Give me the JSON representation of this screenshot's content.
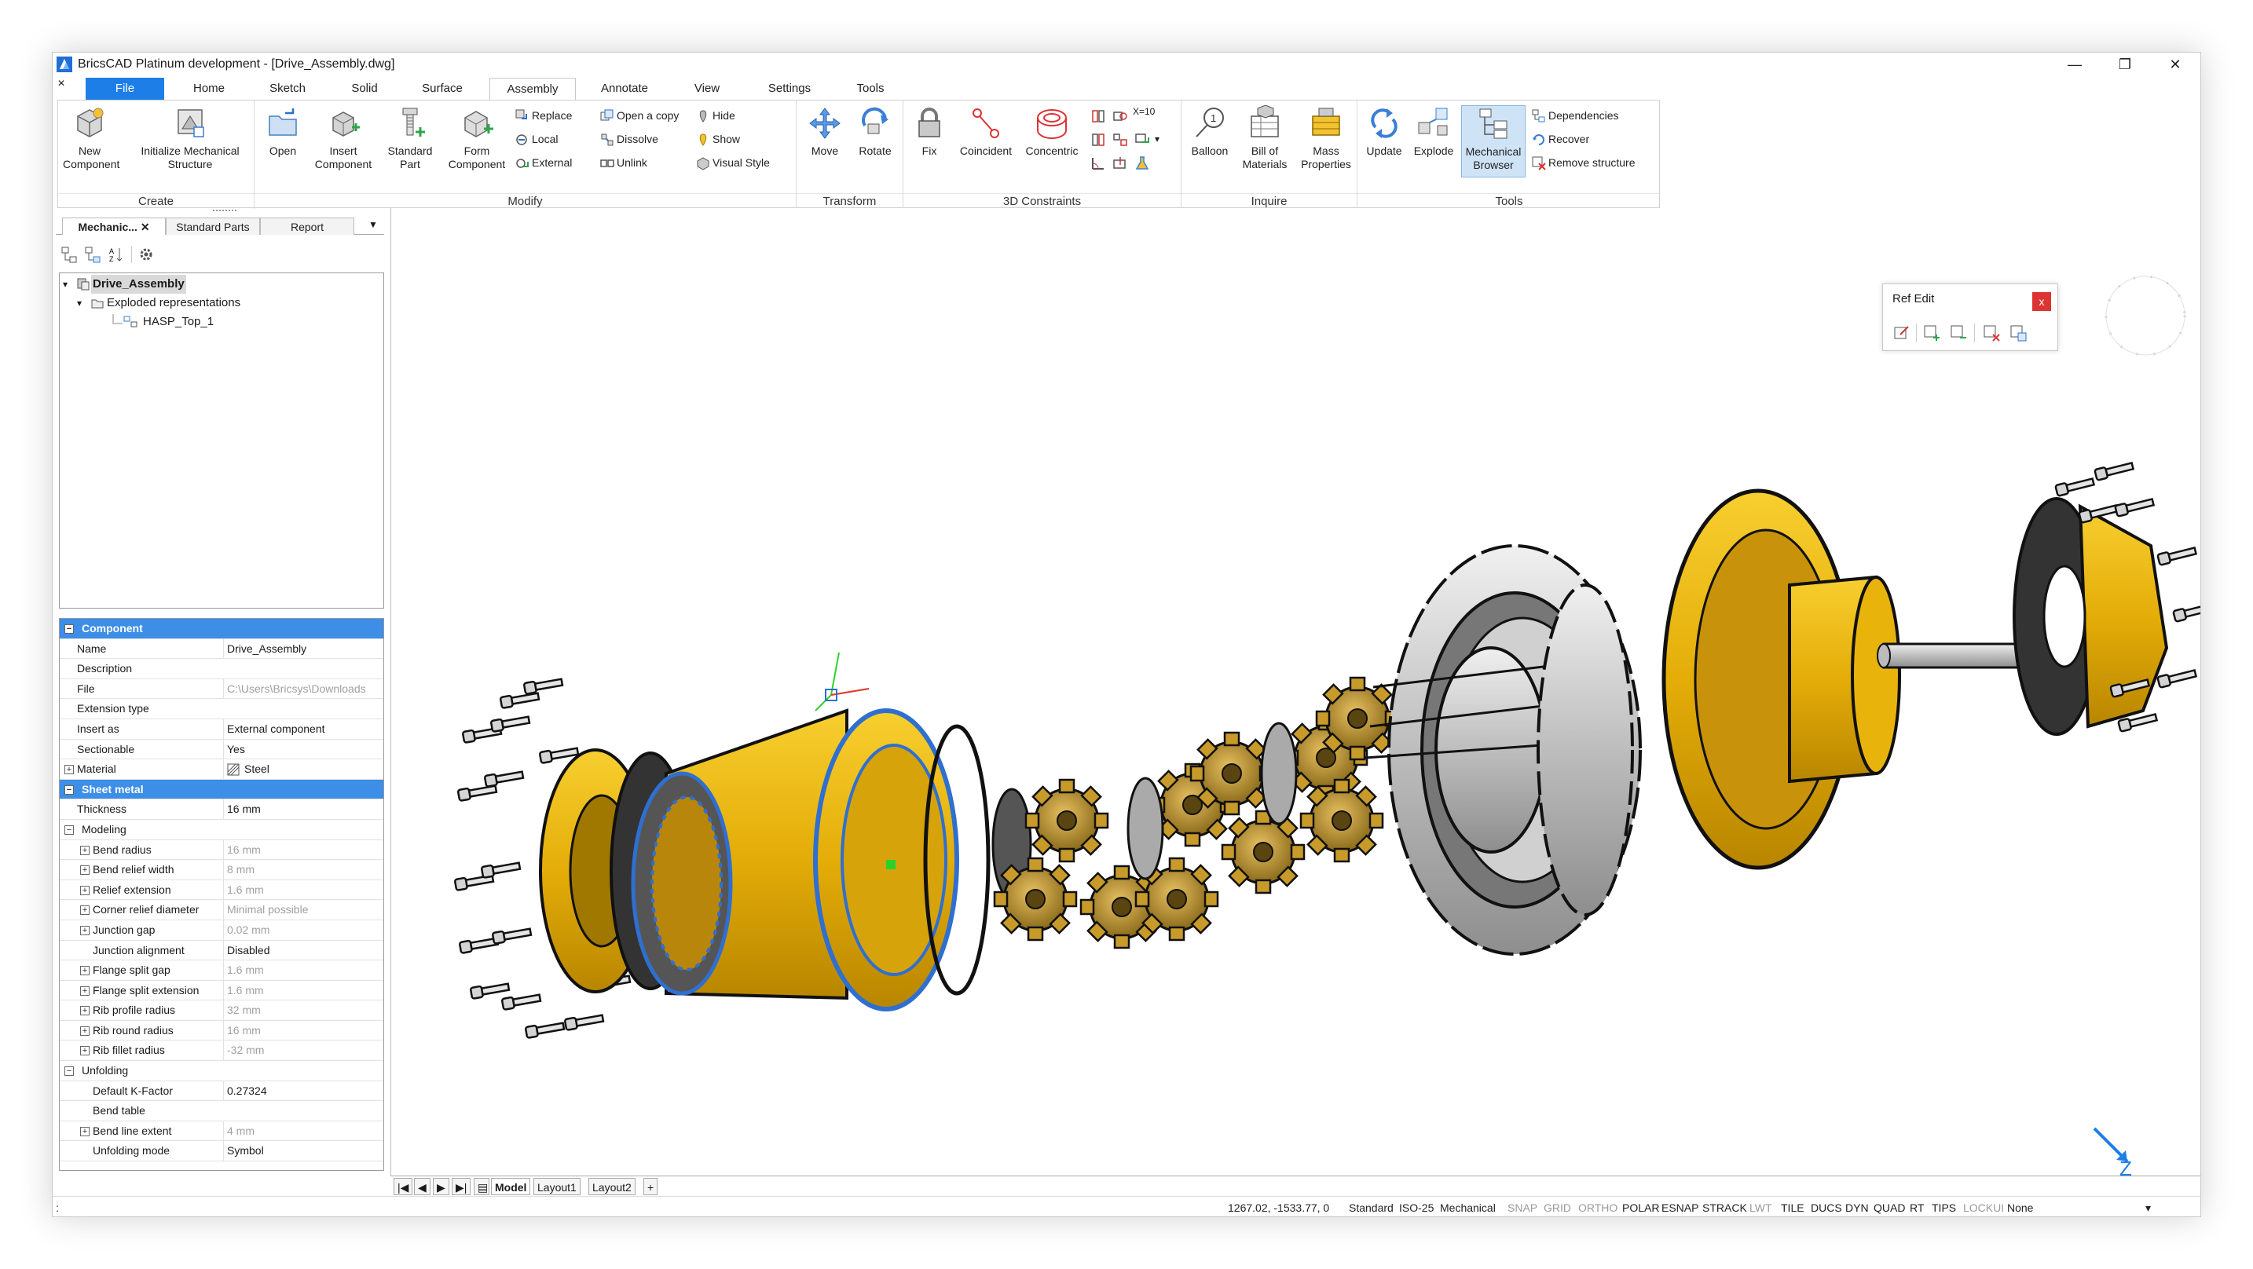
{
  "window": {
    "title": "BricsCAD Platinum development - [Drive_Assembly.dwg]",
    "controls": {
      "minimize": "—",
      "restore": "❐",
      "close": "✕"
    }
  },
  "ribbon_tabs": [
    "File",
    "Home",
    "Sketch",
    "Solid",
    "Surface",
    "Assembly",
    "Annotate",
    "View",
    "Settings",
    "Tools"
  ],
  "ribbon": {
    "create": {
      "title": "Create",
      "new_component": "New Component",
      "initialize": "Initialize Mechanical Structure"
    },
    "modify": {
      "title": "Modify",
      "open": "Open",
      "insert_component": "Insert Component",
      "standard_part": "Standard Part",
      "form_component": "Form Component",
      "replace": "Replace",
      "local": "Local",
      "external": "External",
      "open_copy": "Open a copy",
      "dissolve": "Dissolve",
      "unlink": "Unlink",
      "hide": "Hide",
      "show": "Show",
      "visual_style": "Visual Style"
    },
    "transform": {
      "title": "Transform",
      "move": "Move",
      "rotate": "Rotate"
    },
    "constraints": {
      "title": "3D Constraints",
      "fix": "Fix",
      "coincident": "Coincident",
      "concentric": "Concentric",
      "xlabel": "X=10"
    },
    "inquire": {
      "title": "Inquire",
      "balloon": "Balloon",
      "bom": "Bill of Materials",
      "mass": "Mass Properties"
    },
    "tools": {
      "title": "Tools",
      "update": "Update",
      "explode": "Explode",
      "mech_browser": "Mechanical Browser",
      "dependencies": "Dependencies",
      "recover": "Recover",
      "remove_structure": "Remove structure"
    }
  },
  "left_tabs": [
    "Mechanic...",
    "Standard Parts",
    "Report"
  ],
  "left_tab_close": "✕",
  "tree": {
    "root": "Drive_Assembly",
    "child": "Exploded representations",
    "leaf": "HASP_Top_1"
  },
  "properties": [
    {
      "kind": "sec",
      "name": "Component",
      "exp": "⊟"
    },
    {
      "kind": "row",
      "name": "Name",
      "value": "Drive_Assembly"
    },
    {
      "kind": "row",
      "name": "Description",
      "value": ""
    },
    {
      "kind": "row",
      "name": "File",
      "value": "C:\\Users\\Bricsys\\Downloads",
      "gray": true
    },
    {
      "kind": "row",
      "name": "Extension type",
      "value": ""
    },
    {
      "kind": "row",
      "name": "Insert as",
      "value": "External component"
    },
    {
      "kind": "row",
      "name": "Sectionable",
      "value": "Yes"
    },
    {
      "kind": "row",
      "name": "Material",
      "value": "Steel",
      "exp": "⊞",
      "hatch": true
    },
    {
      "kind": "sec",
      "name": "Sheet metal",
      "exp": "⊟"
    },
    {
      "kind": "row",
      "name": "Thickness",
      "value": "16 mm"
    },
    {
      "kind": "grp",
      "name": "Modeling",
      "exp": "⊟"
    },
    {
      "kind": "sub",
      "name": "Bend radius",
      "value": "16 mm",
      "gray": true,
      "exp": "⊞"
    },
    {
      "kind": "sub",
      "name": "Bend relief width",
      "value": "8 mm",
      "gray": true,
      "exp": "⊞"
    },
    {
      "kind": "sub",
      "name": "Relief extension",
      "value": "1.6 mm",
      "gray": true,
      "exp": "⊞"
    },
    {
      "kind": "sub",
      "name": "Corner relief diameter",
      "value": "Minimal possible",
      "gray": true,
      "exp": "⊞"
    },
    {
      "kind": "sub",
      "name": "Junction gap",
      "value": "0.02 mm",
      "gray": true,
      "exp": "⊞"
    },
    {
      "kind": "sub",
      "name": "Junction alignment",
      "value": "Disabled"
    },
    {
      "kind": "sub",
      "name": "Flange split gap",
      "value": "1.6 mm",
      "gray": true,
      "exp": "⊞"
    },
    {
      "kind": "sub",
      "name": "Flange split extension",
      "value": "1.6 mm",
      "gray": true,
      "exp": "⊞"
    },
    {
      "kind": "sub",
      "name": "Rib profile radius",
      "value": "32 mm",
      "gray": true,
      "exp": "⊞"
    },
    {
      "kind": "sub",
      "name": "Rib round radius",
      "value": "16 mm",
      "gray": true,
      "exp": "⊞"
    },
    {
      "kind": "sub",
      "name": "Rib fillet radius",
      "value": "-32 mm",
      "gray": true,
      "exp": "⊞"
    },
    {
      "kind": "grp",
      "name": "Unfolding",
      "exp": "⊟"
    },
    {
      "kind": "sub",
      "name": "Default K-Factor",
      "value": "0.27324"
    },
    {
      "kind": "sub",
      "name": "Bend table",
      "value": ""
    },
    {
      "kind": "sub",
      "name": "Bend line extent",
      "value": "4 mm",
      "gray": true,
      "exp": "⊞"
    },
    {
      "kind": "sub",
      "name": "Unfolding mode",
      "value": "Symbol"
    }
  ],
  "refedit": {
    "title": "Ref Edit",
    "close": "x"
  },
  "axis_label": "Z",
  "layout_tabs": [
    "Model",
    "Layout1",
    "Layout2"
  ],
  "layout_nav": [
    "|◀",
    "◀",
    "▶",
    "▶|",
    "+"
  ],
  "status": {
    "coords": "1267.02, -1533.77, 0",
    "items": [
      {
        "t": "Standard",
        "off": false
      },
      {
        "t": "ISO-25",
        "off": false
      },
      {
        "t": "Mechanical",
        "off": false
      },
      {
        "t": "SNAP",
        "off": true
      },
      {
        "t": "GRID",
        "off": true
      },
      {
        "t": "ORTHO",
        "off": true
      },
      {
        "t": "POLAR",
        "off": false
      },
      {
        "t": "ESNAP",
        "off": false
      },
      {
        "t": "STRACK",
        "off": false
      },
      {
        "t": "LWT",
        "off": true
      },
      {
        "t": "TILE",
        "off": false
      },
      {
        "t": "DUCS",
        "off": false
      },
      {
        "t": "DYN",
        "off": false
      },
      {
        "t": "QUAD",
        "off": false
      },
      {
        "t": "RT",
        "off": false
      },
      {
        "t": "TIPS",
        "off": false
      },
      {
        "t": "LOCKUI",
        "off": true
      },
      {
        "t": "None",
        "off": false
      }
    ],
    "prompt": ":"
  },
  "colors": {
    "accent": "#1e7ee8",
    "gold": "#e8b40c",
    "gold_dark": "#b08000",
    "steel": "#c8c8c8",
    "selection": "#2f6fd0"
  }
}
